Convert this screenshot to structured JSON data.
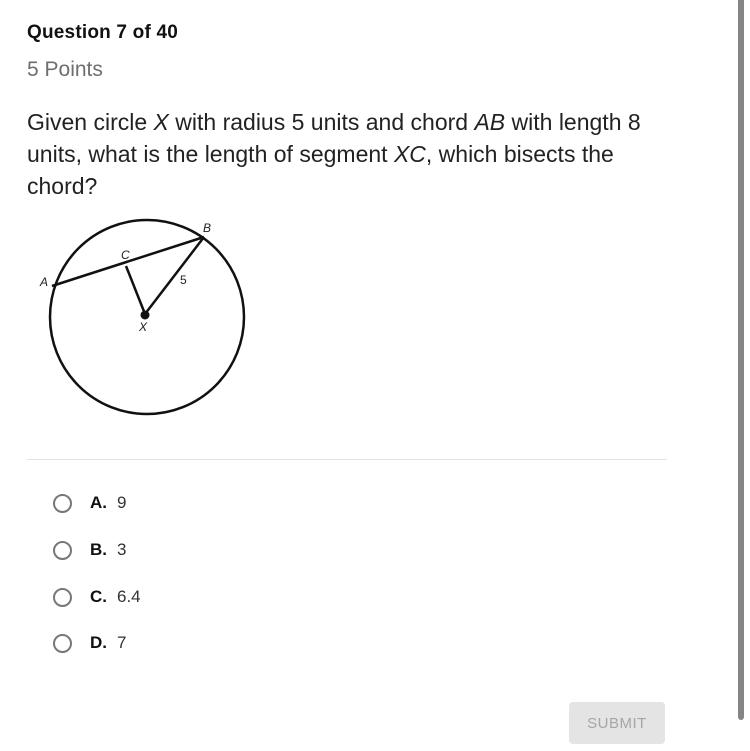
{
  "question": {
    "header": "Question 7 of 40",
    "points": "5 Points",
    "text_parts": [
      {
        "t": "Given circle ",
        "italic": false
      },
      {
        "t": "X",
        "italic": true
      },
      {
        "t": " with radius 5 units and chord ",
        "italic": false
      },
      {
        "t": "AB",
        "italic": true
      },
      {
        "t": " with length 8 units, what is the length of segment ",
        "italic": false
      },
      {
        "t": "XC",
        "italic": true
      },
      {
        "t": ", which bisects the chord?",
        "italic": false
      }
    ]
  },
  "diagram": {
    "point_labels": {
      "A": "A",
      "B": "B",
      "C": "C",
      "X": "X"
    },
    "radius_label": "5"
  },
  "choices": [
    {
      "letter": "A.",
      "value": "9",
      "selected": false
    },
    {
      "letter": "B.",
      "value": "3",
      "selected": false
    },
    {
      "letter": "C.",
      "value": "6.4",
      "selected": false
    },
    {
      "letter": "D.",
      "value": "7",
      "selected": false
    }
  ],
  "submit": {
    "label": "SUBMIT",
    "enabled": false
  },
  "colors": {
    "submit_bg": "#e4e4e4",
    "submit_text": "#a6a6a6",
    "radio_border": "#777777",
    "points_text": "#6e6e6e"
  }
}
